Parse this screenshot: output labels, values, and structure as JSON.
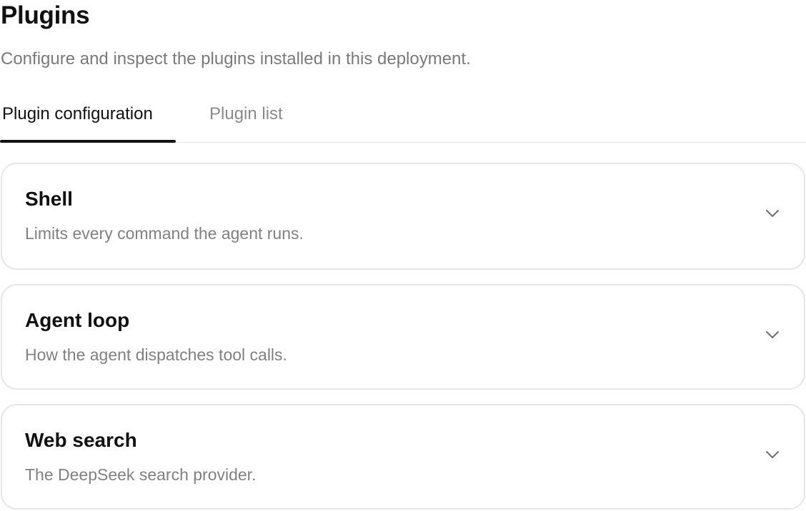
{
  "header": {
    "title": "Plugins",
    "subtitle": "Configure and inspect the plugins installed in this deployment."
  },
  "tabs": [
    {
      "label": "Plugin configuration",
      "active": true
    },
    {
      "label": "Plugin list",
      "active": false
    }
  ],
  "cards": [
    {
      "title": "Shell",
      "description": "Limits every command the agent runs.",
      "icon": "chevron-down-icon"
    },
    {
      "title": "Agent loop",
      "description": "How the agent dispatches tool calls.",
      "icon": "chevron-down-icon"
    },
    {
      "title": "Web search",
      "description": "The DeepSeek search provider.",
      "icon": "chevron-down-icon"
    }
  ],
  "colors": {
    "text_primary": "#111111",
    "text_secondary": "#7a7a7a",
    "border": "#e6e6e6",
    "tab_indicator": "#111111"
  }
}
